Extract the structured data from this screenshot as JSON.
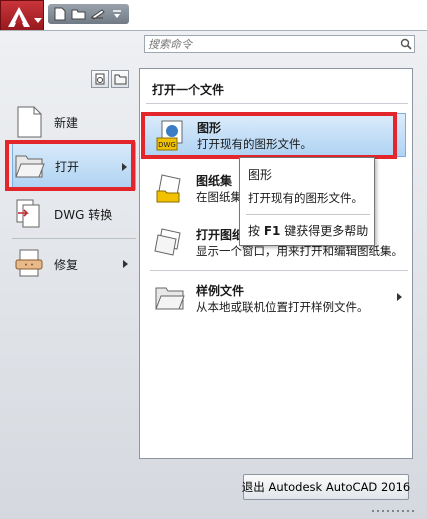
{
  "search": {
    "placeholder": "搜索命令"
  },
  "left_menu": {
    "items": [
      {
        "label": "新建",
        "icon": "new-document-icon",
        "has_submenu": false
      },
      {
        "label": "打开",
        "icon": "open-folder-icon",
        "has_submenu": true,
        "selected": true
      },
      {
        "label": "DWG 转换",
        "icon": "dwg-convert-icon",
        "has_submenu": false
      },
      {
        "label": "修复",
        "icon": "repair-icon",
        "has_submenu": true
      }
    ]
  },
  "open_panel": {
    "title": "打开一个文件",
    "items": [
      {
        "title": "图形",
        "desc": "打开现有的图形文件。",
        "icon": "dwg-file-icon",
        "selected": true
      },
      {
        "title": "图纸集",
        "desc": "在图纸集",
        "icon": "sheetset-open-icon"
      },
      {
        "title": "打开图纸",
        "desc": "显示一个窗口，用来打开和编辑图纸集。",
        "icon": "sheetset-manager-icon"
      },
      {
        "title": "样例文件",
        "desc": "从本地或联机位置打开样例文件。",
        "icon": "sample-folder-icon",
        "has_submenu": true
      }
    ]
  },
  "tooltip": {
    "title": "图形",
    "desc": "打开现有的图形文件。",
    "help": "按 F1 键获得更多帮助",
    "help_key": "F1"
  },
  "exit_button": {
    "label": "退出 Autodesk AutoCAD 2016"
  },
  "colors": {
    "accent_red": "#e3262c",
    "selection_blue": "#aed2f2",
    "app_button": "#b1272c"
  }
}
